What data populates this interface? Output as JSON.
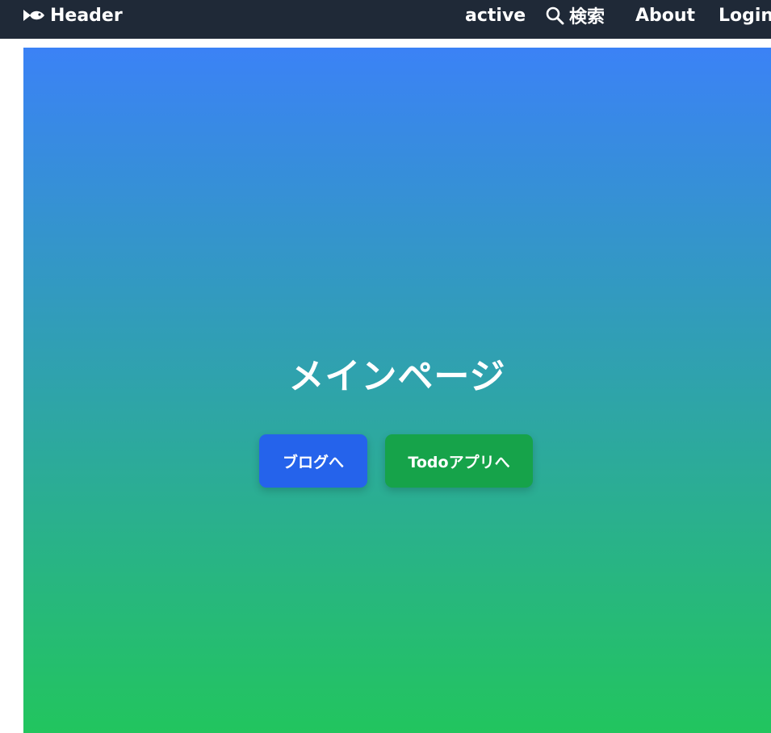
{
  "header": {
    "brand_icon": "fish-icon",
    "brand_label": "Header",
    "nav": {
      "active_label": "active",
      "search_icon": "search-icon",
      "search_label": "検索",
      "about_label": "About",
      "login_label": "Login"
    }
  },
  "hero": {
    "title": "メインページ",
    "gradient_top": "#3b82f6",
    "gradient_bottom": "#22c55e",
    "buttons": {
      "blog_label": "ブログへ",
      "blog_color": "#2563eb",
      "todo_label": "Todoアプリへ",
      "todo_color": "#16a34a"
    }
  },
  "colors": {
    "header_bg": "#1f2937",
    "text": "#ffffff"
  }
}
